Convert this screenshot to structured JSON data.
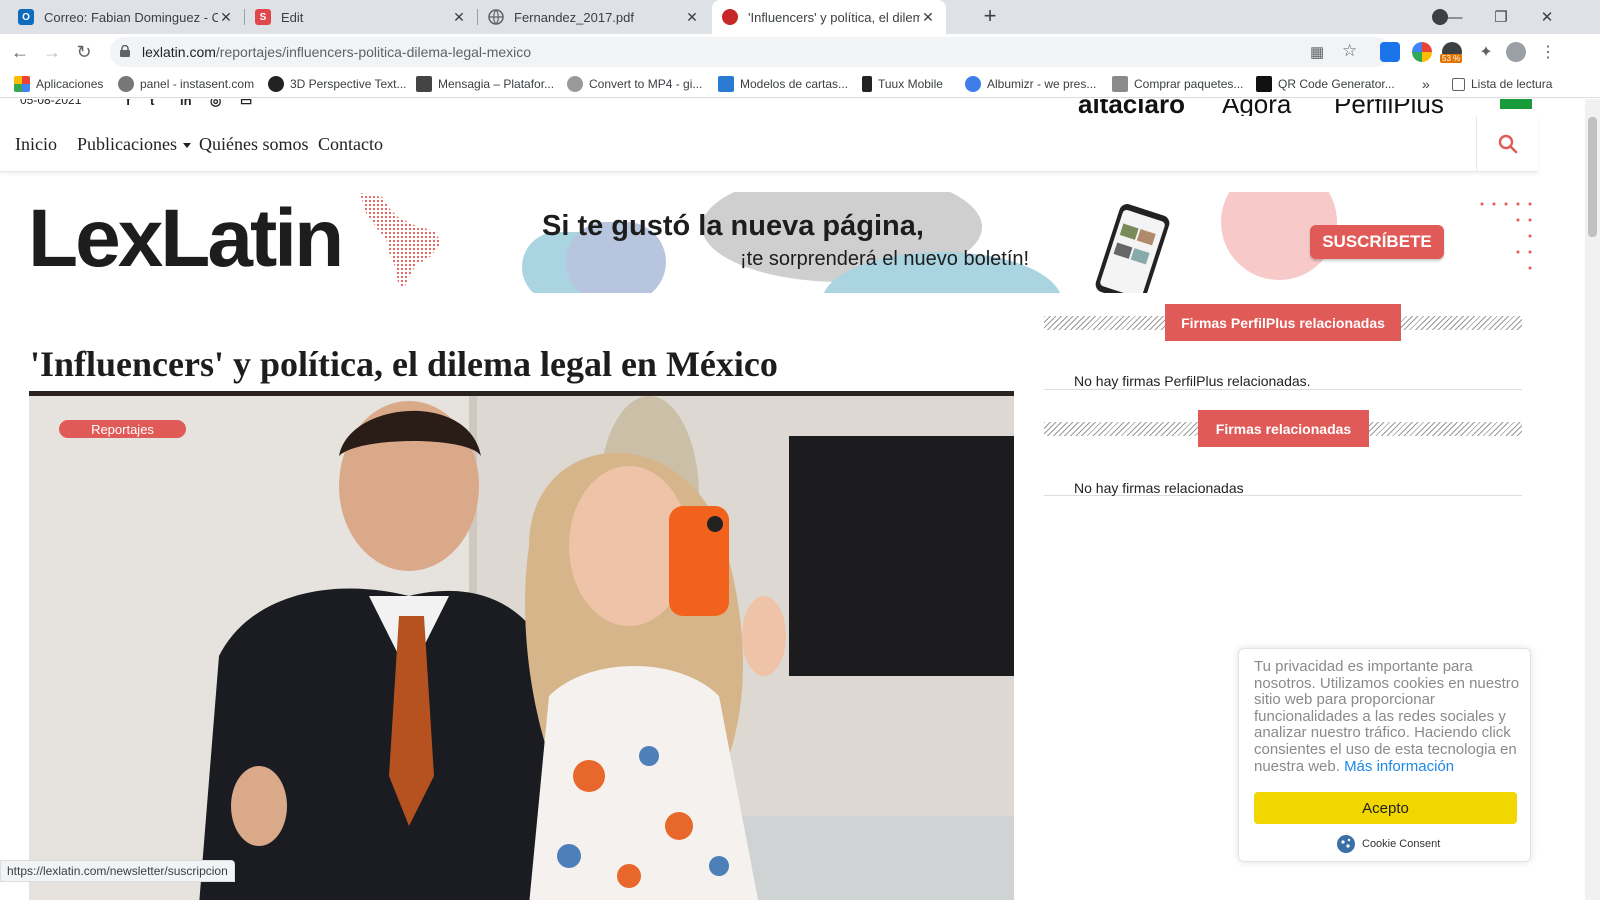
{
  "browser": {
    "tabs": [
      {
        "title": "Correo: Fabian Dominguez - Outl",
        "icon": "outlook-icon",
        "color": "#0f6cbd",
        "glyph": "O"
      },
      {
        "title": "Edit",
        "icon": "s-app-icon",
        "color": "#e0474c",
        "glyph": "S"
      },
      {
        "title": "Fernandez_2017.pdf",
        "icon": "globe-icon",
        "color": "#5f6368",
        "glyph": ""
      },
      {
        "title": "'Influencers' y política, el dilema l",
        "icon": "lexlatin-favicon",
        "color": "#c62828",
        "glyph": ""
      }
    ],
    "url_host": "lexlatin.com",
    "url_path": "/reportajes/influencers-politica-dilema-legal-mexico",
    "extension_badge": "53 %",
    "bookmarks": [
      {
        "label": "Aplicaciones",
        "icon": "apps-grid-icon"
      },
      {
        "label": "panel - instasent.com",
        "icon": "instasent-icon"
      },
      {
        "label": "3D Perspective Text...",
        "icon": "3d-text-icon"
      },
      {
        "label": "Mensagia – Platafor...",
        "icon": "mensagia-icon"
      },
      {
        "label": "Convert to MP4 - gi...",
        "icon": "convert-icon"
      },
      {
        "label": "Modelos de cartas...",
        "icon": "w-icon"
      },
      {
        "label": "Tuux Mobile",
        "icon": "tuux-icon"
      },
      {
        "label": "Albumizr - we pres...",
        "icon": "albumizr-icon"
      },
      {
        "label": "Comprar paquetes...",
        "icon": "paquetes-icon"
      },
      {
        "label": "QR Code Generator...",
        "icon": "qr-icon"
      }
    ],
    "overflow_label": "»",
    "reading_list": "Lista de lectura",
    "status_url": "https://lexlatin.com/newsletter/suscripcion"
  },
  "site": {
    "date": "05-08-2021",
    "partners": [
      "altaclaro",
      "Ágora",
      "PerfilPlus"
    ],
    "nav": [
      "Inicio",
      "Publicaciones",
      "Quiénes somos",
      "Contacto"
    ],
    "logo": "LexLatin",
    "banner": {
      "headline": "Si te gustó la nueva página,",
      "subline": "¡te sorprenderá el nuevo boletín!",
      "button": "SUSCRÍBETE"
    },
    "article": {
      "title": "'Influencers' y política, el dilema legal en México",
      "category": "Reportajes"
    },
    "sidebar": [
      {
        "label": "Firmas PerfilPlus relacionadas",
        "empty": "No hay firmas PerfilPlus relacionadas."
      },
      {
        "label": "Firmas relacionadas",
        "empty": "No hay firmas relacionadas"
      }
    ],
    "cookie": {
      "text": "Tu privacidad es importante para nosotros. Utilizamos cookies en nuestro sitio web para proporcionar funcionalidades a las redes sociales y analizar nuestro tráfico. Haciendo click consientes el uso de esta tecnologia en nuestra web.",
      "more": "Más información",
      "accept": "Acepto",
      "brand": "Cookie Consent"
    },
    "colors": {
      "accent": "#e05a57",
      "accept": "#f2d600"
    }
  }
}
